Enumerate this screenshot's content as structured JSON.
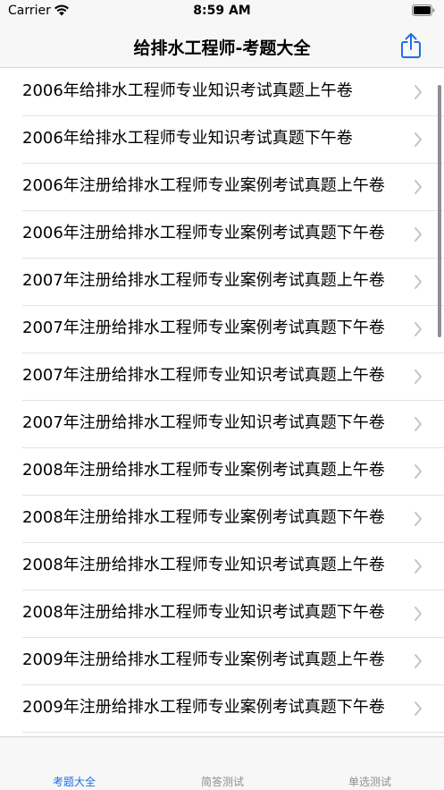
{
  "status_bar": {
    "carrier": "Carrier",
    "time": "8:59 AM"
  },
  "nav_bar": {
    "title": "给排水工程师-考题大全",
    "share_icon": "share-icon"
  },
  "list": {
    "items": [
      {
        "label": "2006年给排水工程师专业知识考试真题上午卷"
      },
      {
        "label": "2006年给排水工程师专业知识考试真题下午卷"
      },
      {
        "label": "2006年注册给排水工程师专业案例考试真题上午卷"
      },
      {
        "label": "2006年注册给排水工程师专业案例考试真题下午卷"
      },
      {
        "label": "2007年注册给排水工程师专业案例考试真题上午卷"
      },
      {
        "label": "2007年注册给排水工程师专业案例考试真题下午卷"
      },
      {
        "label": "2007年注册给排水工程师专业知识考试真题上午卷"
      },
      {
        "label": "2007年注册给排水工程师专业知识考试真题下午卷"
      },
      {
        "label": "2008年注册给排水工程师专业案例考试真题上午卷"
      },
      {
        "label": "2008年注册给排水工程师专业案例考试真题下午卷"
      },
      {
        "label": "2008年注册给排水工程师专业知识考试真题上午卷"
      },
      {
        "label": "2008年注册给排水工程师专业知识考试真题下午卷"
      },
      {
        "label": "2009年注册给排水工程师专业案例考试真题上午卷"
      },
      {
        "label": "2009年注册给排水工程师专业案例考试真题下午卷"
      }
    ]
  },
  "tab_bar": {
    "tabs": [
      {
        "label": "考题大全",
        "active": true
      },
      {
        "label": "简答测试",
        "active": false
      },
      {
        "label": "单选测试",
        "active": false
      }
    ]
  },
  "colors": {
    "accent": "#1f6fe5",
    "inactive_tab": "#8e8e93",
    "chevron": "#c4c4c7"
  }
}
